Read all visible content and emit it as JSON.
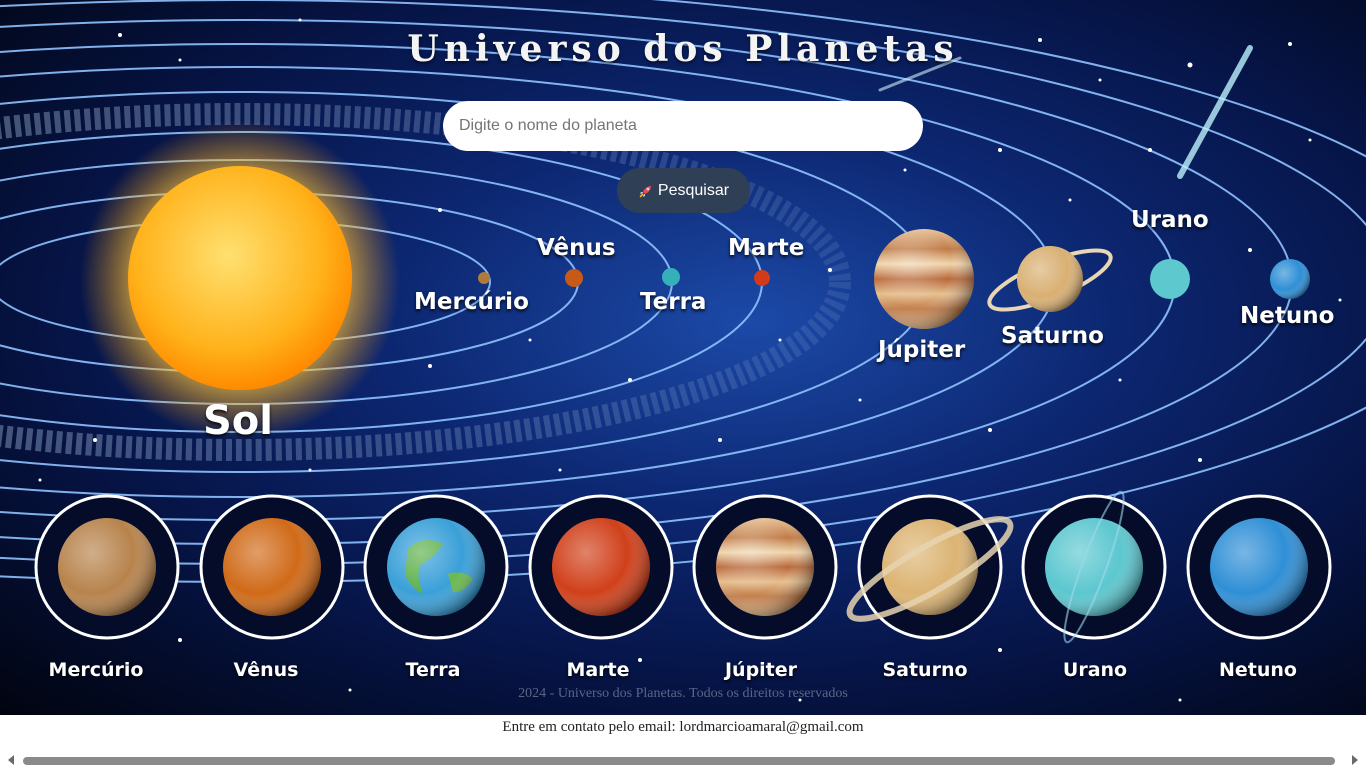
{
  "header": {
    "title": "Universo dos Planetas"
  },
  "search": {
    "placeholder": "Digite o nome do planeta",
    "value": "",
    "button_label": "Pesquisar",
    "button_icon": "rocket-icon"
  },
  "solar_system_labels": {
    "sun": "Sol",
    "mercury": "Mercúrio",
    "venus": "Vênus",
    "earth": "Terra",
    "mars": "Marte",
    "jupiter": "Júpiter",
    "saturn": "Saturno",
    "uranus": "Urano",
    "neptune": "Netuno"
  },
  "planet_cards": [
    {
      "name": "Mercúrio",
      "color": "#b7834c"
    },
    {
      "name": "Vênus",
      "color": "#d06a18"
    },
    {
      "name": "Terra",
      "color": "#3aa0d8"
    },
    {
      "name": "Marte",
      "color": "#d0401a"
    },
    {
      "name": "Júpiter",
      "color": "#d7a46a"
    },
    {
      "name": "Saturno",
      "color": "#dcb473"
    },
    {
      "name": "Urano",
      "color": "#5cc7cf"
    },
    {
      "name": "Netuno",
      "color": "#2f8fd6"
    }
  ],
  "footer": {
    "copyright": "2024 - Universo dos Planetas. Todos os direitos reservados",
    "contact": "Entre em contato pelo email: lordmarcioamaral@gmail.com"
  },
  "colors": {
    "accent_button": "#2f3f55",
    "orbit": "#8fc3ff",
    "sun": "#ffb020"
  }
}
